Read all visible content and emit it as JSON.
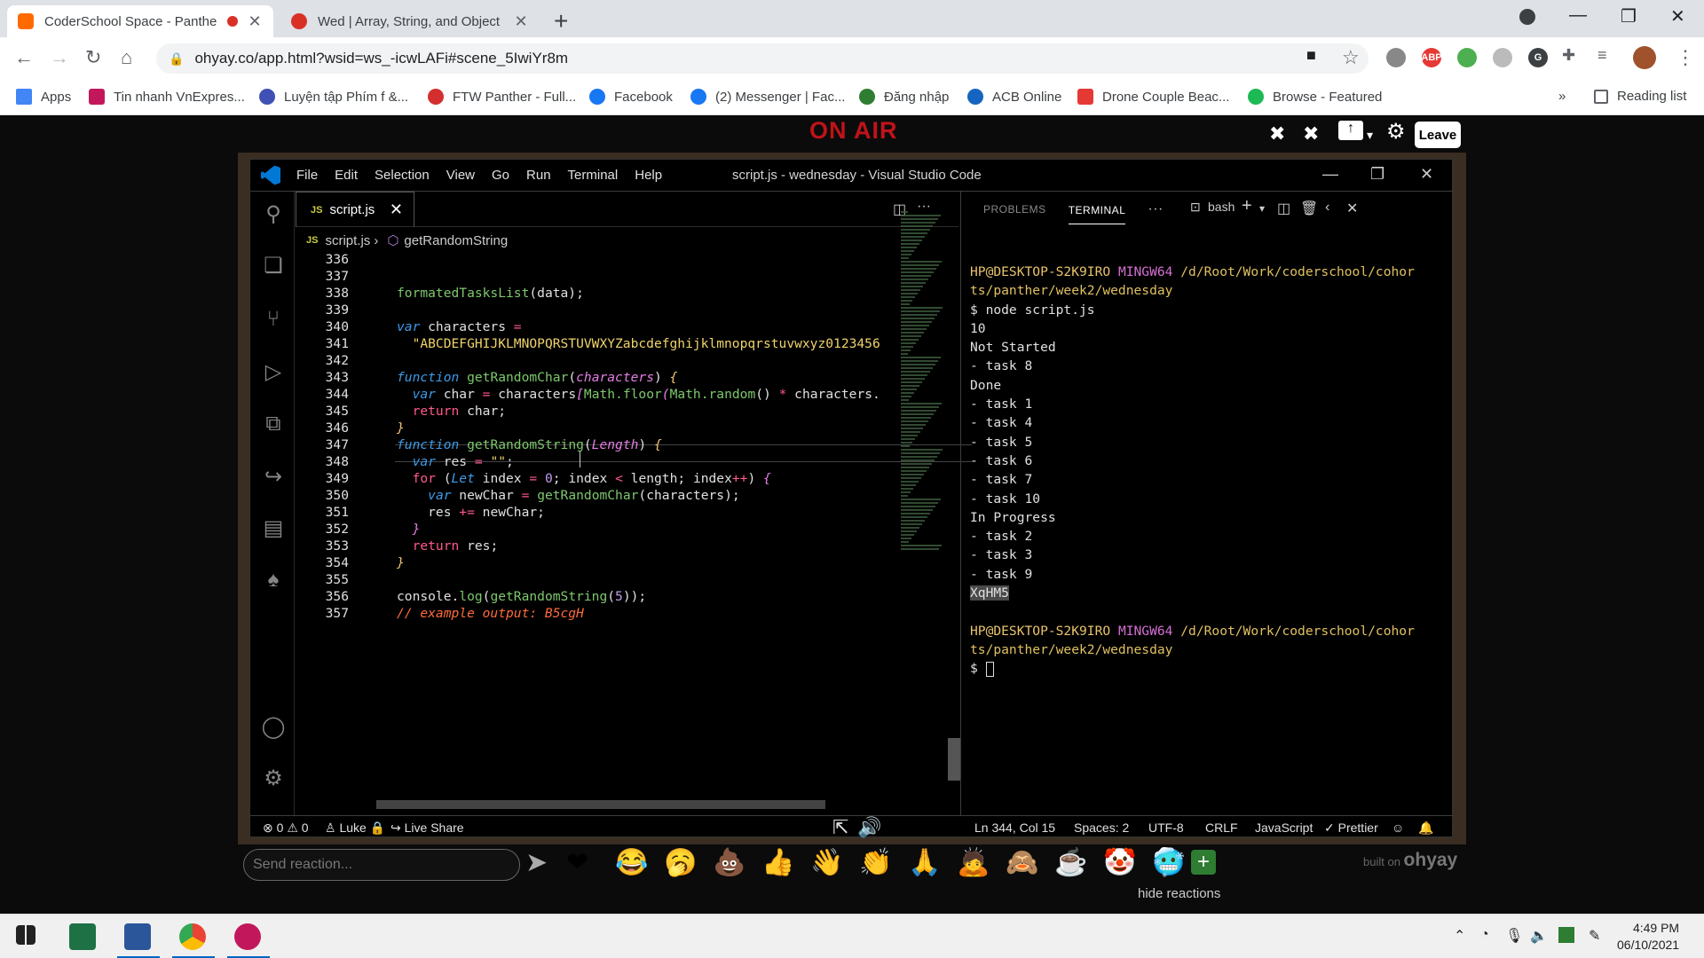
{
  "browser": {
    "tabs": [
      {
        "title": "CoderSchool Space - Panthe",
        "active": true,
        "recording": true
      },
      {
        "title": "Wed | Array, String, and Object",
        "active": false,
        "recording": false
      }
    ],
    "url": "ohyay.co/app.html?wsid=ws_-icwLAFi#scene_5IwiYr8m",
    "bookmarks": [
      "Apps",
      "Tin nhanh VnExpres...",
      "Luyện tập Phím f &...",
      "FTW Panther - Full...",
      "Facebook",
      "(2) Messenger | Fac...",
      "Đăng nhập",
      "ACB Online",
      "Drone Couple Beac...",
      "Browse - Featured"
    ],
    "reading_list": "Reading list"
  },
  "ohyay": {
    "on_air": "ON AIR",
    "leave": "Leave",
    "reaction_placeholder": "Send reaction...",
    "hide_reactions": "hide reactions",
    "built_on": "built on",
    "brand": "ohyay",
    "emojis": [
      "❤",
      "😂",
      "🥱",
      "💩",
      "👍",
      "👋",
      "👏",
      "🙏",
      "🙇",
      "🙈",
      "☕",
      "🤡",
      "🥶"
    ]
  },
  "vscode": {
    "menu": [
      "File",
      "Edit",
      "Selection",
      "View",
      "Go",
      "Run",
      "Terminal",
      "Help"
    ],
    "title": "script.js - wednesday - Visual Studio Code",
    "tab": {
      "badge": "JS",
      "name": "script.js"
    },
    "breadcrumb": {
      "file": "script.js",
      "symbol": "getRandomString"
    },
    "line_numbers": [
      "336",
      "337",
      "338",
      "339",
      "340",
      "341",
      "342",
      "343",
      "344",
      "345",
      "346",
      "347",
      "348",
      "349",
      "350",
      "351",
      "352",
      "353",
      "354",
      "355",
      "356",
      "357"
    ],
    "panel_tabs": [
      "PROBLEMS",
      "TERMINAL"
    ],
    "shell": "bash",
    "terminal": {
      "prompt1": "HP@DESKTOP-S2K9IRO",
      "mingw1": "MINGW64",
      "path1a": "/d/Root/Work/coderschool/cohor",
      "path1b": "ts/panther/week2/wednesday",
      "cmd": "$ node script.js",
      "output": [
        "10",
        "Not Started",
        "- task 8",
        "Done",
        "- task 1",
        "- task 4",
        "- task 5",
        "- task 6",
        "- task 7",
        "- task 10",
        "In Progress",
        "- task 2",
        "- task 3",
        "- task 9"
      ],
      "random": "XqHM5",
      "prompt2": "HP@DESKTOP-S2K9IRO",
      "mingw2": "MINGW64",
      "path2a": "/d/Root/Work/coderschool/cohor",
      "path2b": "ts/panther/week2/wednesday",
      "dollar": "$"
    },
    "status": {
      "errors": "0",
      "warnings": "0",
      "branch": "Luke",
      "live_share": "Live Share",
      "position": "Ln 344, Col 15",
      "spaces": "Spaces: 2",
      "encoding": "UTF-8",
      "eol": "CRLF",
      "language": "JavaScript",
      "prettier": "Prettier"
    }
  },
  "taskbar": {
    "time": "4:49 PM",
    "date": "06/10/2021"
  },
  "colors": {
    "accent": "#0078d4",
    "on_air": "#c0131a",
    "terminal_prompt": "#e8c36a",
    "terminal_mingw": "#d670d6"
  }
}
